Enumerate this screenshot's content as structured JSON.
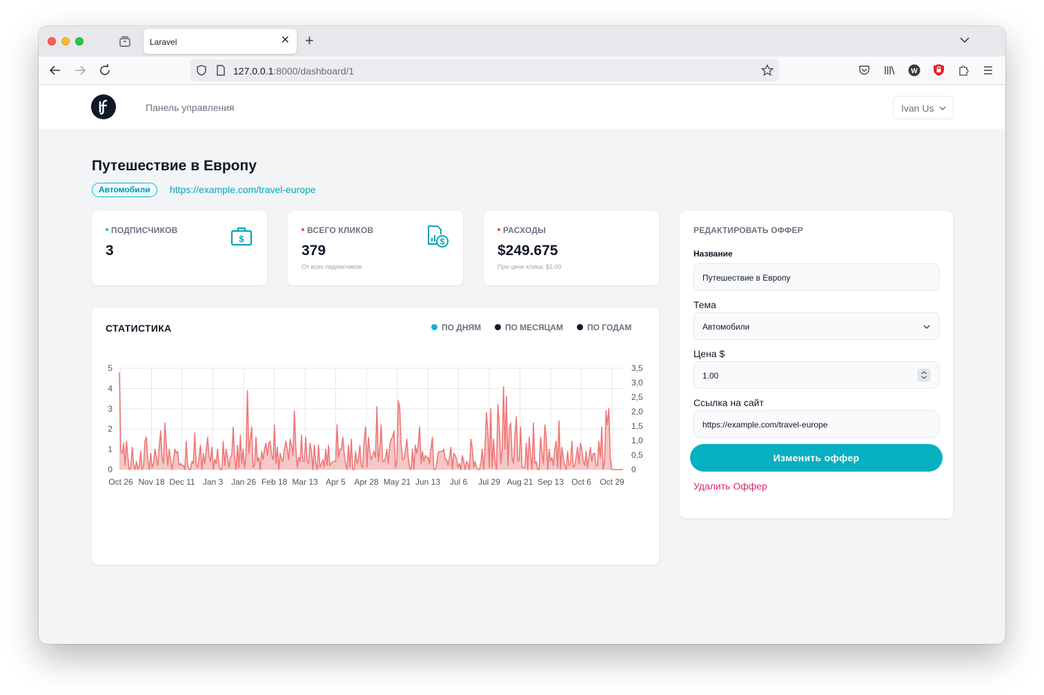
{
  "browser": {
    "tab_title": "Laravel",
    "url_host": "127.0.0.1",
    "url_path": ":8000/dashboard/1"
  },
  "header": {
    "nav_link": "Панель управления",
    "user_name": "Ivan Us"
  },
  "offer": {
    "title": "Путешествие в Европу",
    "category": "Автомобили",
    "link": "https://example.com/travel-europe"
  },
  "stats": [
    {
      "label": "ПОДПИСЧИКОВ",
      "value": "3",
      "sub": "",
      "dot_color": "#06b6d4",
      "icon": "briefcase-dollar-icon"
    },
    {
      "label": "ВСЕГО КЛИКОВ",
      "value": "379",
      "sub": "От всех подписчиков",
      "dot_color": "#ef4444",
      "icon": "report-dollar-icon"
    },
    {
      "label": "РАСХОДЫ",
      "value": "$249.675",
      "sub": "При цене клика: $1.00",
      "dot_color": "#ef4444",
      "icon": ""
    }
  ],
  "statistics": {
    "title": "СТАТИСТИКА",
    "legend": [
      {
        "label": "ПО ДНЯМ",
        "color": "#06b6d4"
      },
      {
        "label": "ПО МЕСЯЦАМ",
        "color": "#111827"
      },
      {
        "label": "ПО ГОДАМ",
        "color": "#111827"
      }
    ]
  },
  "chart_data": {
    "type": "line",
    "title": "",
    "xlabel": "",
    "ylabel": "",
    "x_tick_labels": [
      "Oct 26",
      "Nov 18",
      "Dec 11",
      "Jan 3",
      "Jan 26",
      "Feb 18",
      "Mar 13",
      "Apr 5",
      "Apr 28",
      "May 21",
      "Jun 13",
      "Jul 6",
      "Jul 29",
      "Aug 21",
      "Sep 13",
      "Oct 6",
      "Oct 29"
    ],
    "y_left": {
      "ylim": [
        0,
        5
      ],
      "ticks": [
        "0",
        "1",
        "2",
        "3",
        "4",
        "5"
      ]
    },
    "y_right": {
      "ylim": [
        0,
        3.5
      ],
      "ticks": [
        "0",
        "0,5",
        "1,0",
        "1,5",
        "2,0",
        "2,5",
        "3,0",
        "3,5"
      ]
    },
    "grid": true,
    "series": [
      {
        "axis": "left",
        "color": "#ee7777",
        "fill": "#f1b4b4",
        "values": [
          4.8,
          0.9,
          0.8,
          1.3,
          0.2,
          1.4,
          0.6,
          0.0,
          0.1,
          1.1,
          0.3,
          0.0,
          0.4,
          0.0,
          0.2,
          0.9,
          0.0,
          0.2,
          1.4,
          1.6,
          0.5,
          0.0,
          0.8,
          0.1,
          0.3,
          1.0,
          0.6,
          0.2,
          1.1,
          1.9,
          0.6,
          0.3,
          2.3,
          1.2,
          0.2,
          1.0,
          0.5,
          0.0,
          0.5,
          1.0,
          0.8,
          0.9,
          0.2,
          0.3,
          0.2,
          0.2,
          0.0,
          1.4,
          0.2,
          0.0,
          0.0,
          0.4,
          0.3,
          1.8,
          0.2,
          0.1,
          0.6,
          1.2,
          0.0,
          0.8,
          0.3,
          0.9,
          1.6,
          0.7,
          0.4,
          1.1,
          0.0,
          0.5,
          0.3,
          1.0,
          0.3,
          0.0,
          0.0,
          1.4,
          0.2,
          1.0,
          0.6,
          0.1,
          0.6,
          0.7,
          2.1,
          0.6,
          0.0,
          1.2,
          0.1,
          1.7,
          0.3,
          1.0,
          0.1,
          0.7,
          3.9,
          0.8,
          1.5,
          2.1,
          0.1,
          0.2,
          1.6,
          0.4,
          0.6,
          0.0,
          0.9,
          0.5,
          1.0,
          1.3,
          0.7,
          1.3,
          1.4,
          0.7,
          0.5,
          2.2,
          0.3,
          1.1,
          0.0,
          0.8,
          0.5,
          0.4,
          1.0,
          1.4,
          1.0,
          0.5,
          1.5,
          1.2,
          0.7,
          2.9,
          1.1,
          0.1,
          0.6,
          0.4,
          1.7,
          0.4,
          0.4,
          1.6,
          0.4,
          0.3,
          1.3,
          0.9,
          0.0,
          1.2,
          0.3,
          0.0,
          1.2,
          0.1,
          0.3,
          0.5,
          0.1,
          1.0,
          0.2,
          1.2,
          0.2,
          0.3,
          0.4,
          0.4,
          0.4,
          2.2,
          0.6,
          1.0,
          1.0,
          1.6,
          0.8,
          0.3,
          0.0,
          1.2,
          0.1,
          1.5,
          0.0,
          0.0,
          0.9,
          0.3,
          0.5,
          1.2,
          0.2,
          0.1,
          1.4,
          2.1,
          0.1,
          1.6,
          0.9,
          0.5,
          0.7,
          0.9,
          0.6,
          3.1,
          0.4,
          1.0,
          2.2,
          0.4,
          0.4,
          0.6,
          1.0,
          0.3,
          1.2,
          1.5,
          1.6,
          1.9,
          0.1,
          0.4,
          3.4,
          3.1,
          1.3,
          0.5,
          0.5,
          0.9,
          1.5,
          0.6,
          0.1,
          0.0,
          1.0,
          0.0,
          1.2,
          0.8,
          1.2,
          2.1,
          0.3,
          0.9,
          0.4,
          0.7,
          0.6,
          0.6,
          0.3,
          1.1,
          1.6,
          0.0,
          0.0,
          0.3,
          0.8,
          0.9,
          0.9,
          0.9,
          1.0,
          0.5,
          0.5,
          0.2,
          0.6,
          1.1,
          0.0,
          0.8,
          0.7,
          0.5,
          0.1,
          0.3,
          0.0,
          0.7,
          0.4,
          0.0,
          0.4,
          0.3,
          0.0,
          1.5,
          1.1,
          0.1,
          0.4,
          0.1,
          0.0,
          0.0,
          0.3,
          1.0,
          0.0,
          1.2,
          2.8,
          1.8,
          0.1,
          3.0,
          0.1,
          1.5,
          0.4,
          0.0,
          3.2,
          2.2,
          0.3,
          1.0,
          4.1,
          1.0,
          3.6,
          0.2,
          2.0,
          2.3,
          0.6,
          0.3,
          1.7,
          2.6,
          0.4,
          0.5,
          2.1,
          0.1,
          0.1,
          0.1,
          1.3,
          0.0,
          1.6,
          0.7,
          0.0,
          2.3,
          0.3,
          0.4,
          0.0,
          0.0,
          1.6,
          0.8,
          0.3,
          2.2,
          1.6,
          0.0,
          1.0,
          0.4,
          0.6,
          0.2,
          1.0,
          1.4,
          0.1,
          2.4,
          0.0,
          1.1,
          0.6,
          0.2,
          0.0,
          0.9,
          0.2,
          0.3,
          1.4,
          0.1,
          0.2,
          0.6,
          1.1,
          0.3,
          1.3,
          1.0,
          0.4,
          0.2,
          0.9,
          0.1,
          0.6,
          1.1,
          0.4,
          0.8,
          0.8,
          0.2,
          0.2,
          1.4,
          0.6,
          2.1,
          0.0,
          0.4,
          2.9,
          2.2,
          3.0,
          0.6,
          0.0,
          0.0,
          0.0,
          0.0,
          0.0,
          0.0,
          0.0,
          0.0,
          0.0
        ]
      }
    ]
  },
  "form": {
    "title": "РЕДАКТИРОВАТЬ ОФФЕР",
    "name_label": "Название",
    "name_value": "Путешествие в Европу",
    "topic_label": "Тема",
    "topic_value": "Автомобили",
    "price_label": "Цена $",
    "price_value": "1.00",
    "link_label": "Ссылка на сайт",
    "link_value": "https://example.com/travel-europe",
    "submit_label": "Изменить оффер",
    "delete_label": "Удалить Оффер"
  }
}
